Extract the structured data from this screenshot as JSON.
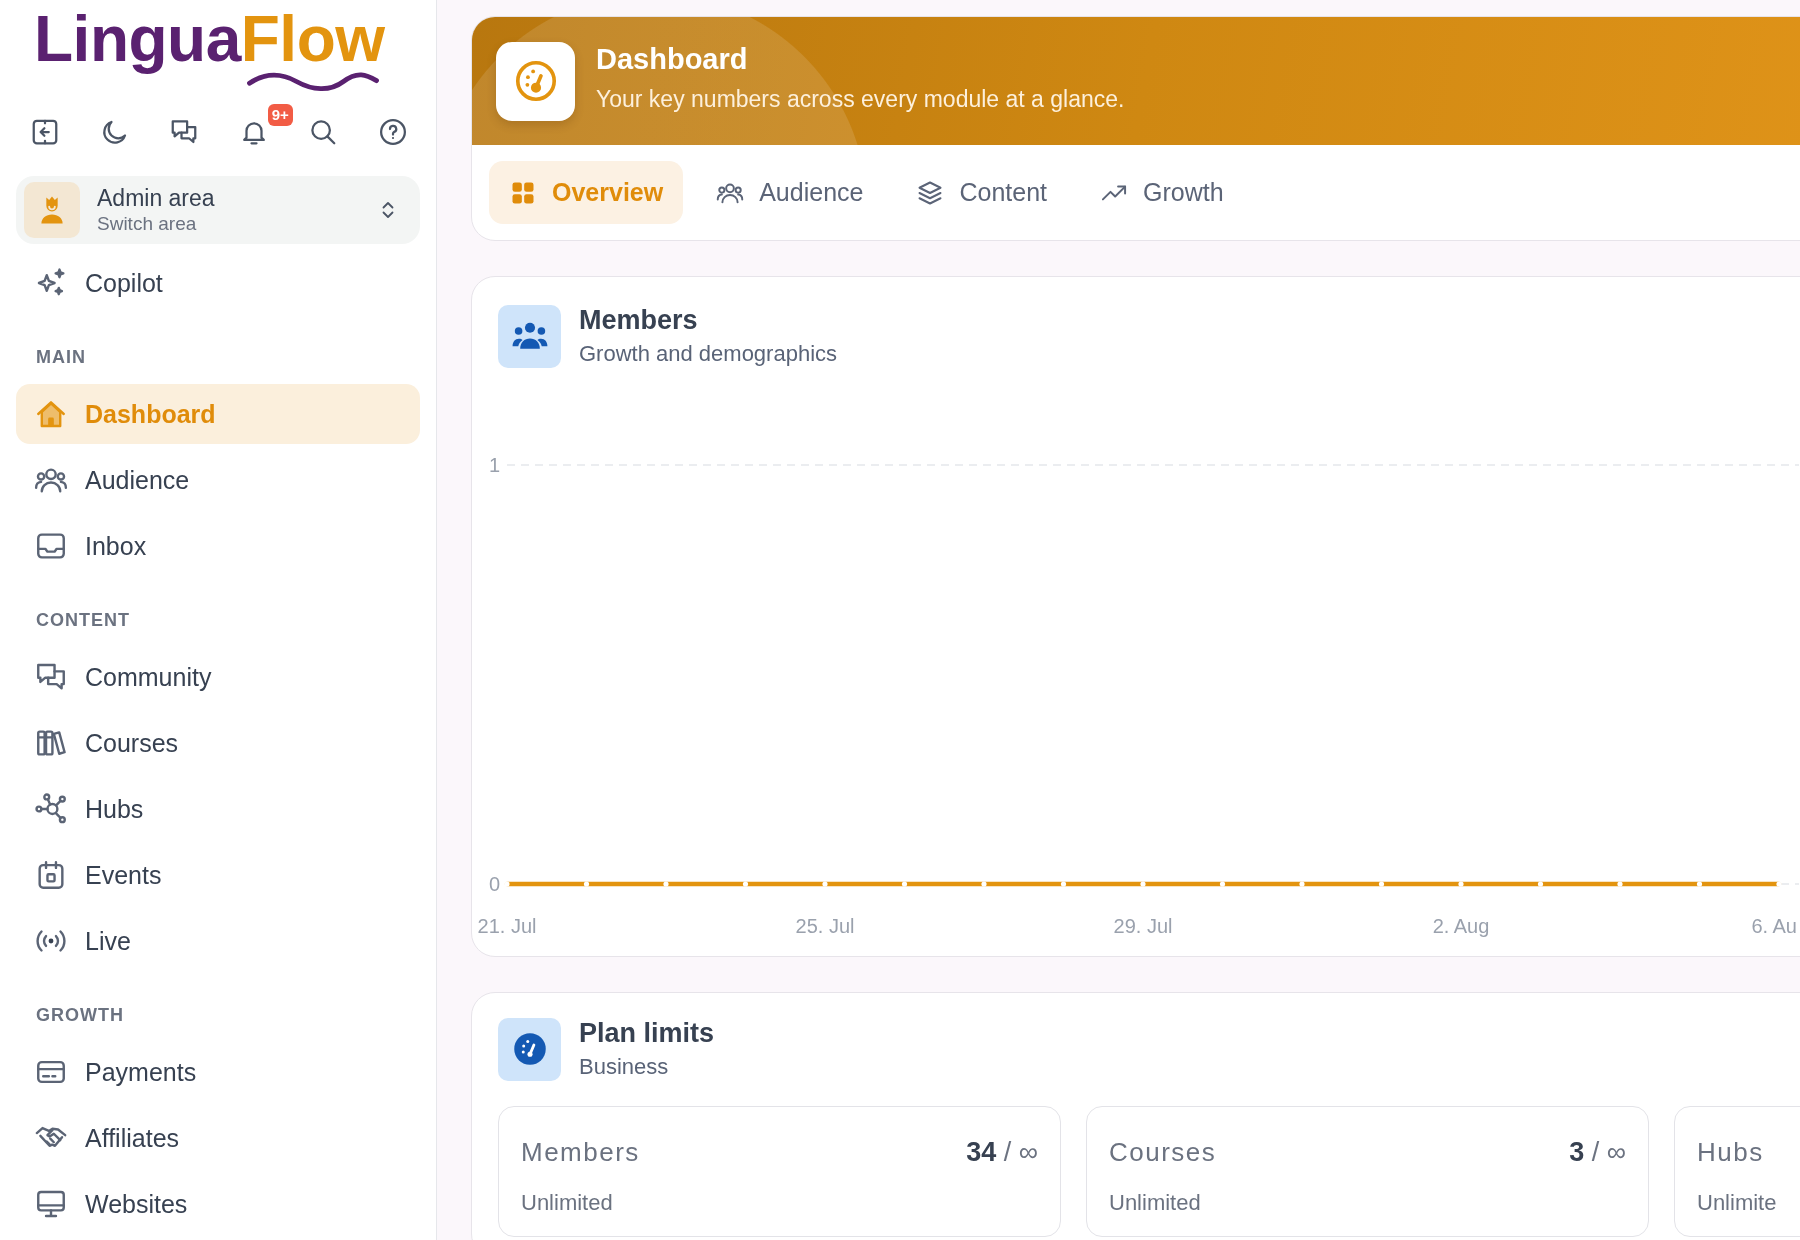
{
  "sidebar": {
    "logo": {
      "primary": "Lingua",
      "accent": "Flow"
    },
    "toolbar": {
      "notification_badge": "9+"
    },
    "area_switcher": {
      "title": "Admin area",
      "subtitle": "Switch area"
    },
    "sections": [
      {
        "items": [
          {
            "label": "Copilot",
            "selected": false
          }
        ]
      },
      {
        "heading": "MAIN",
        "items": [
          {
            "label": "Dashboard",
            "selected": true
          },
          {
            "label": "Audience",
            "selected": false
          },
          {
            "label": "Inbox",
            "selected": false
          }
        ]
      },
      {
        "heading": "CONTENT",
        "items": [
          {
            "label": "Community",
            "selected": false
          },
          {
            "label": "Courses",
            "selected": false
          },
          {
            "label": "Hubs",
            "selected": false
          },
          {
            "label": "Events",
            "selected": false
          },
          {
            "label": "Live",
            "selected": false
          }
        ]
      },
      {
        "heading": "GROWTH",
        "items": [
          {
            "label": "Payments",
            "selected": false
          },
          {
            "label": "Affiliates",
            "selected": false
          },
          {
            "label": "Websites",
            "selected": false
          }
        ]
      }
    ]
  },
  "header": {
    "title": "Dashboard",
    "subtitle": "Your key numbers across every module at a glance.",
    "tabs": [
      {
        "label": "Overview",
        "selected": true
      },
      {
        "label": "Audience",
        "selected": false
      },
      {
        "label": "Content",
        "selected": false
      },
      {
        "label": "Growth",
        "selected": false
      }
    ]
  },
  "members_card": {
    "title": "Members",
    "subtitle": "Growth and demographics",
    "chart_data": {
      "type": "line",
      "categories": [
        "21. Jul",
        null,
        null,
        null,
        "25. Jul",
        null,
        null,
        null,
        "29. Jul",
        null,
        null,
        null,
        "2. Aug",
        null,
        null,
        null,
        "6. Au"
      ],
      "ylim": [
        0,
        1
      ],
      "yticks": [
        0,
        1
      ],
      "series": [
        {
          "color": "#e3940f",
          "values": [
            0,
            0,
            0,
            0,
            0,
            0,
            0,
            0,
            0,
            0,
            0,
            0,
            0,
            0,
            0,
            0,
            0
          ]
        }
      ]
    }
  },
  "plan_limits": {
    "title": "Plan limits",
    "subtitle": "Business",
    "limits": [
      {
        "label": "Members",
        "count": "**34** / ∞",
        "note": "Unlimited"
      },
      {
        "label": "Courses",
        "count": "**3** / ∞",
        "note": "Unlimited"
      },
      {
        "label": "Hubs",
        "note": "Unlimite"
      }
    ]
  }
}
